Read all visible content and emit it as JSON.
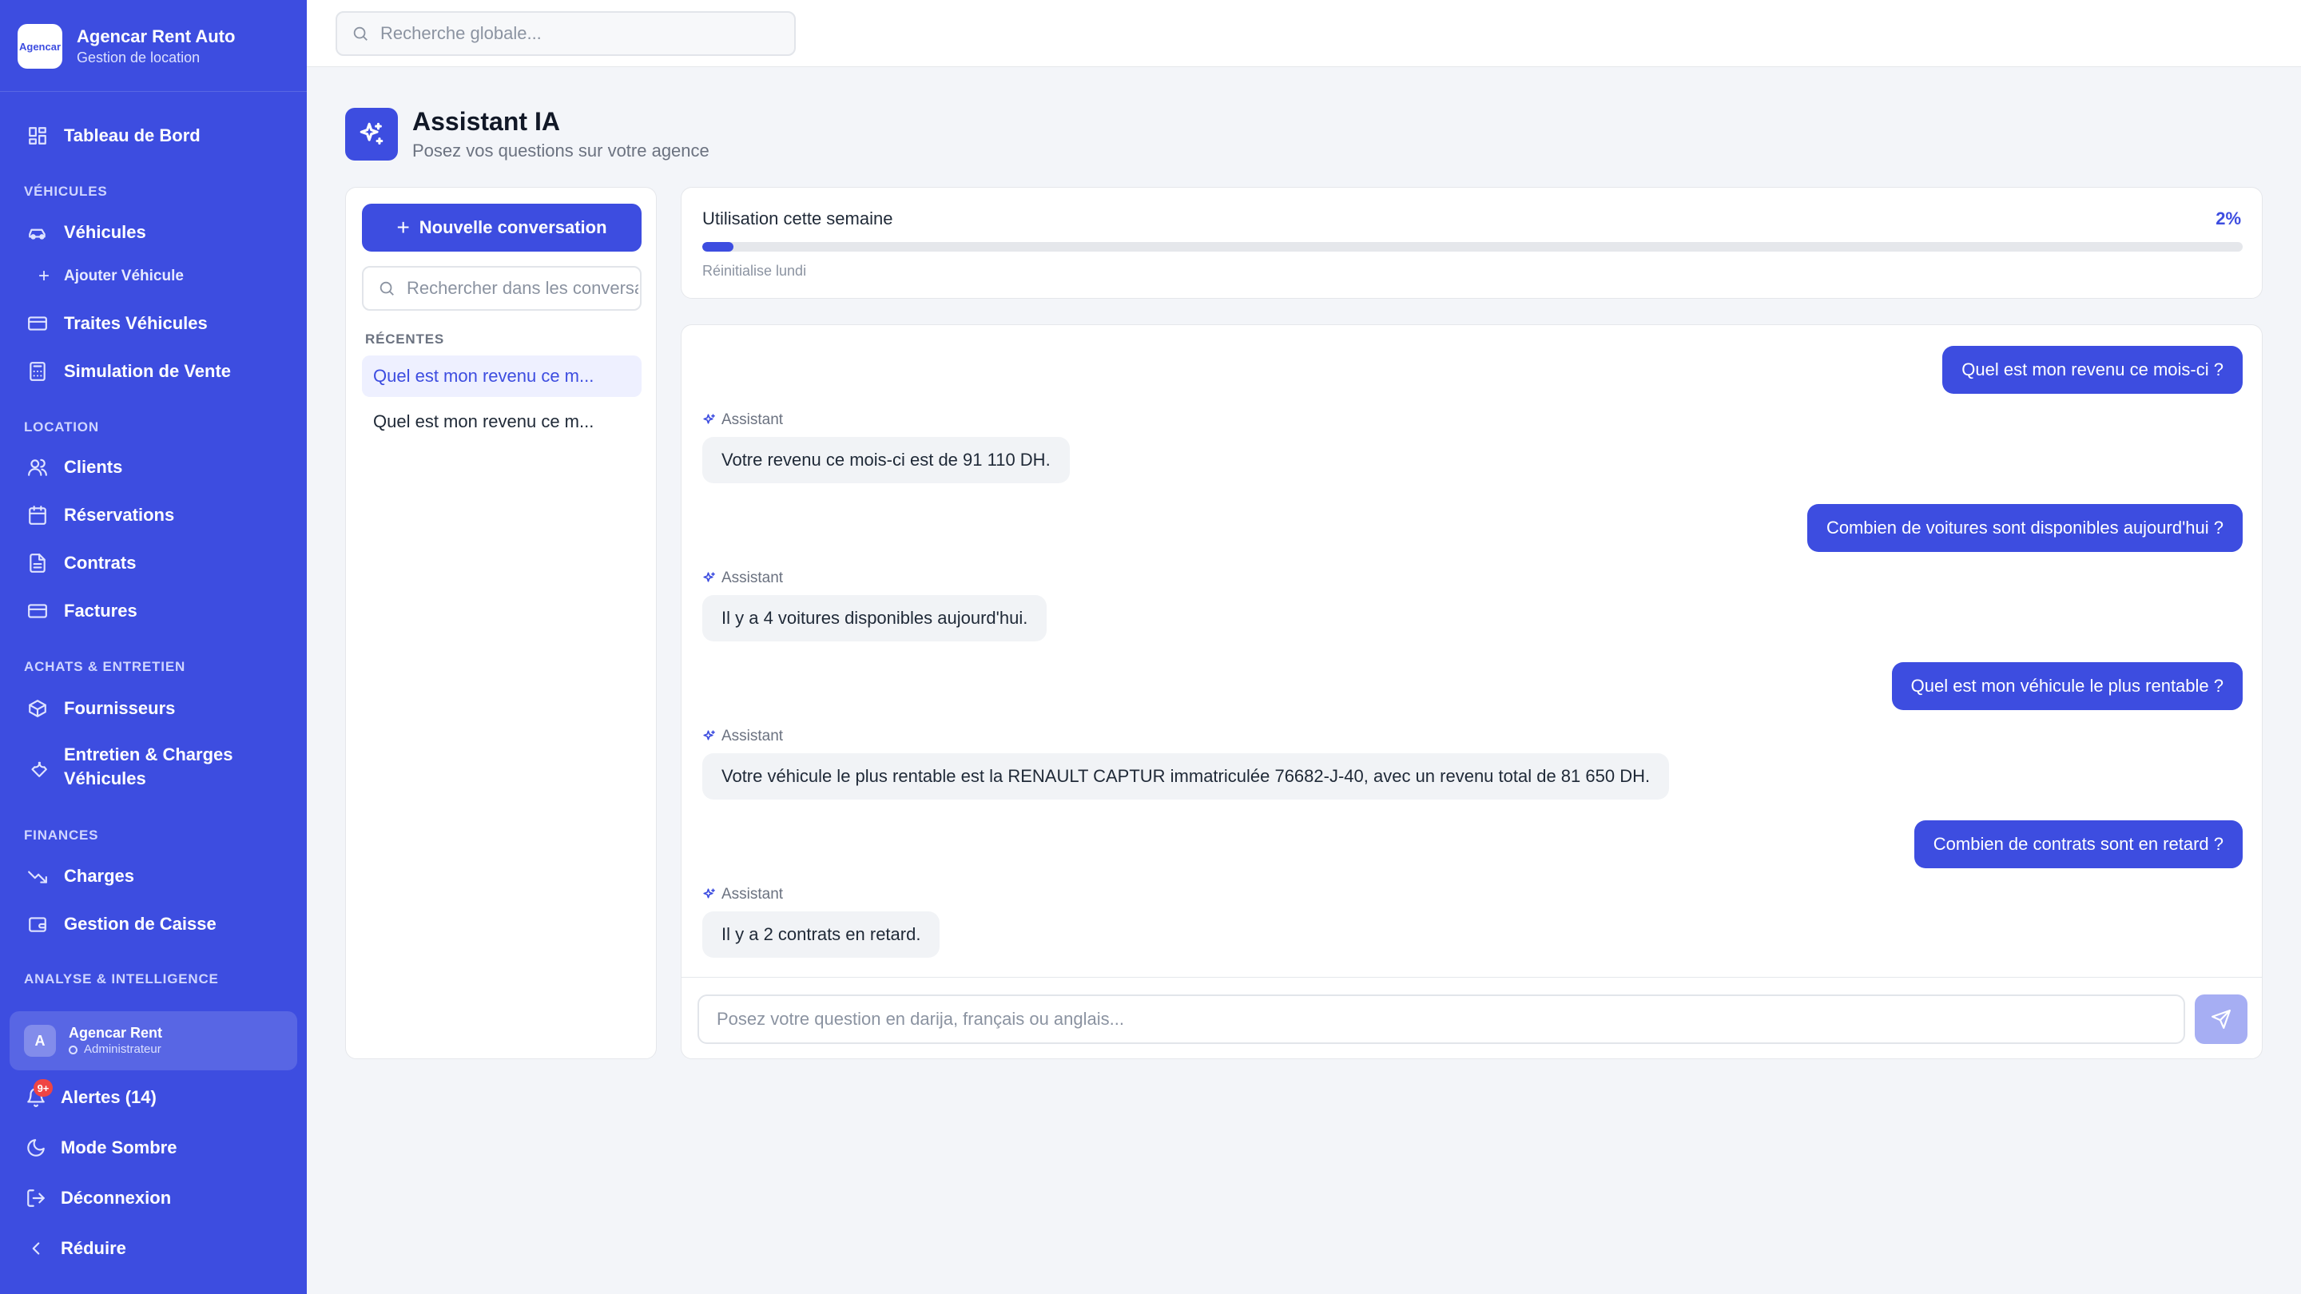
{
  "brand": {
    "name": "Agencar Rent Auto",
    "subtitle": "Gestion de location",
    "logo_text": "Agencar"
  },
  "search": {
    "placeholder": "Recherche globale..."
  },
  "sidebar": {
    "dashboard": "Tableau de Bord",
    "sections": {
      "vehicules": "VÉHICULES",
      "location": "LOCATION",
      "achats": "ACHATS & ENTRETIEN",
      "finances": "FINANCES",
      "analyse": "ANALYSE & INTELLIGENCE"
    },
    "items": {
      "vehicules": "Véhicules",
      "ajouter_vehicule": "Ajouter Véhicule",
      "traites": "Traites Véhicules",
      "simulation": "Simulation de Vente",
      "clients": "Clients",
      "reservations": "Réservations",
      "contrats": "Contrats",
      "factures": "Factures",
      "fournisseurs": "Fournisseurs",
      "entretien_line1": "Entretien & Charges",
      "entretien_line2": "Véhicules",
      "charges": "Charges",
      "caisse": "Gestion de Caisse"
    },
    "user": {
      "initial": "A",
      "name": "Agencar Rent",
      "role": "Administrateur"
    },
    "bottom": {
      "alerts": "Alertes (14)",
      "alerts_badge": "9+",
      "dark_mode": "Mode Sombre",
      "logout": "Déconnexion",
      "collapse": "Réduire"
    }
  },
  "page": {
    "title": "Assistant IA",
    "subtitle": "Posez vos questions sur votre agence"
  },
  "conversations": {
    "new_button": "Nouvelle conversation",
    "search_placeholder": "Rechercher dans les conversations...",
    "recent_label": "RÉCENTES",
    "items": [
      "Quel est mon revenu ce m...",
      "Quel est mon revenu ce m..."
    ]
  },
  "usage": {
    "title": "Utilisation cette semaine",
    "percent_label": "2%",
    "fraction": 0.02,
    "note": "Réinitialise lundi"
  },
  "chat": {
    "assistant_label": "Assistant",
    "messages": [
      {
        "role": "user",
        "text": "Quel est mon revenu ce mois-ci ?"
      },
      {
        "role": "assistant",
        "text": "Votre revenu ce mois-ci est de 91 110 DH."
      },
      {
        "role": "user",
        "text": "Combien de voitures sont disponibles aujourd'hui ?"
      },
      {
        "role": "assistant",
        "text": "Il y a 4 voitures disponibles aujourd'hui."
      },
      {
        "role": "user",
        "text": "Quel est mon véhicule le plus rentable ?"
      },
      {
        "role": "assistant",
        "text": "Votre véhicule le plus rentable est la RENAULT CAPTUR immatriculée 76682-J-40, avec un revenu total de 81 650 DH."
      },
      {
        "role": "user",
        "text": "Combien de contrats sont en retard ?"
      },
      {
        "role": "assistant",
        "text": "Il y a 2 contrats en retard."
      }
    ],
    "input_placeholder": "Posez votre question en darija, français ou anglais..."
  },
  "colors": {
    "accent": "#3d4de0",
    "sidebar": "#3d4de0",
    "badge": "#ef4444"
  }
}
